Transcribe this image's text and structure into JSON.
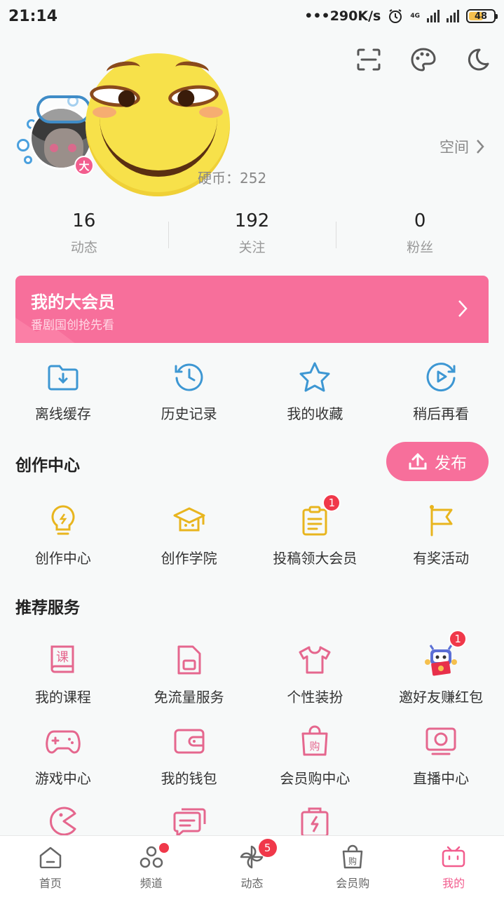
{
  "status": {
    "time": "21:14",
    "network": "•••290K/s",
    "battery": "48",
    "net_type": "4G"
  },
  "profile": {
    "coins_label": "硬币：252",
    "space_label": "空间"
  },
  "stats": [
    {
      "num": "16",
      "label": "动态"
    },
    {
      "num": "192",
      "label": "关注"
    },
    {
      "num": "0",
      "label": "粉丝"
    }
  ],
  "vip": {
    "badge": "大",
    "title": "我的大会员",
    "subtitle": "番剧国创抢先看"
  },
  "quick": [
    {
      "label": "离线缓存"
    },
    {
      "label": "历史记录"
    },
    {
      "label": "我的收藏"
    },
    {
      "label": "稍后再看"
    }
  ],
  "creation": {
    "title": "创作中心",
    "publish": "发布",
    "items": [
      {
        "label": "创作中心"
      },
      {
        "label": "创作学院"
      },
      {
        "label": "投稿领大会员",
        "badge": "1"
      },
      {
        "label": "有奖活动"
      }
    ]
  },
  "services": {
    "title": "推荐服务",
    "row1": [
      {
        "label": "我的课程",
        "icon_text": "课"
      },
      {
        "label": "免流量服务"
      },
      {
        "label": "个性装扮"
      },
      {
        "label": "邀好友赚红包",
        "badge": "1"
      }
    ],
    "row2": [
      {
        "label": "游戏中心"
      },
      {
        "label": "我的钱包"
      },
      {
        "label": "会员购中心",
        "icon_text": "购"
      },
      {
        "label": "直播中心"
      }
    ]
  },
  "nav": [
    {
      "label": "首页"
    },
    {
      "label": "频道"
    },
    {
      "label": "动态",
      "badge": "5"
    },
    {
      "label": "会员购",
      "icon_text": "购"
    },
    {
      "label": "我的"
    }
  ],
  "colors": {
    "accent": "#f25d8e",
    "banner": "#f76f9b",
    "blue_icon": "#3d97d3",
    "gold_icon": "#e8b51e",
    "pink_icon": "#e5678e"
  }
}
